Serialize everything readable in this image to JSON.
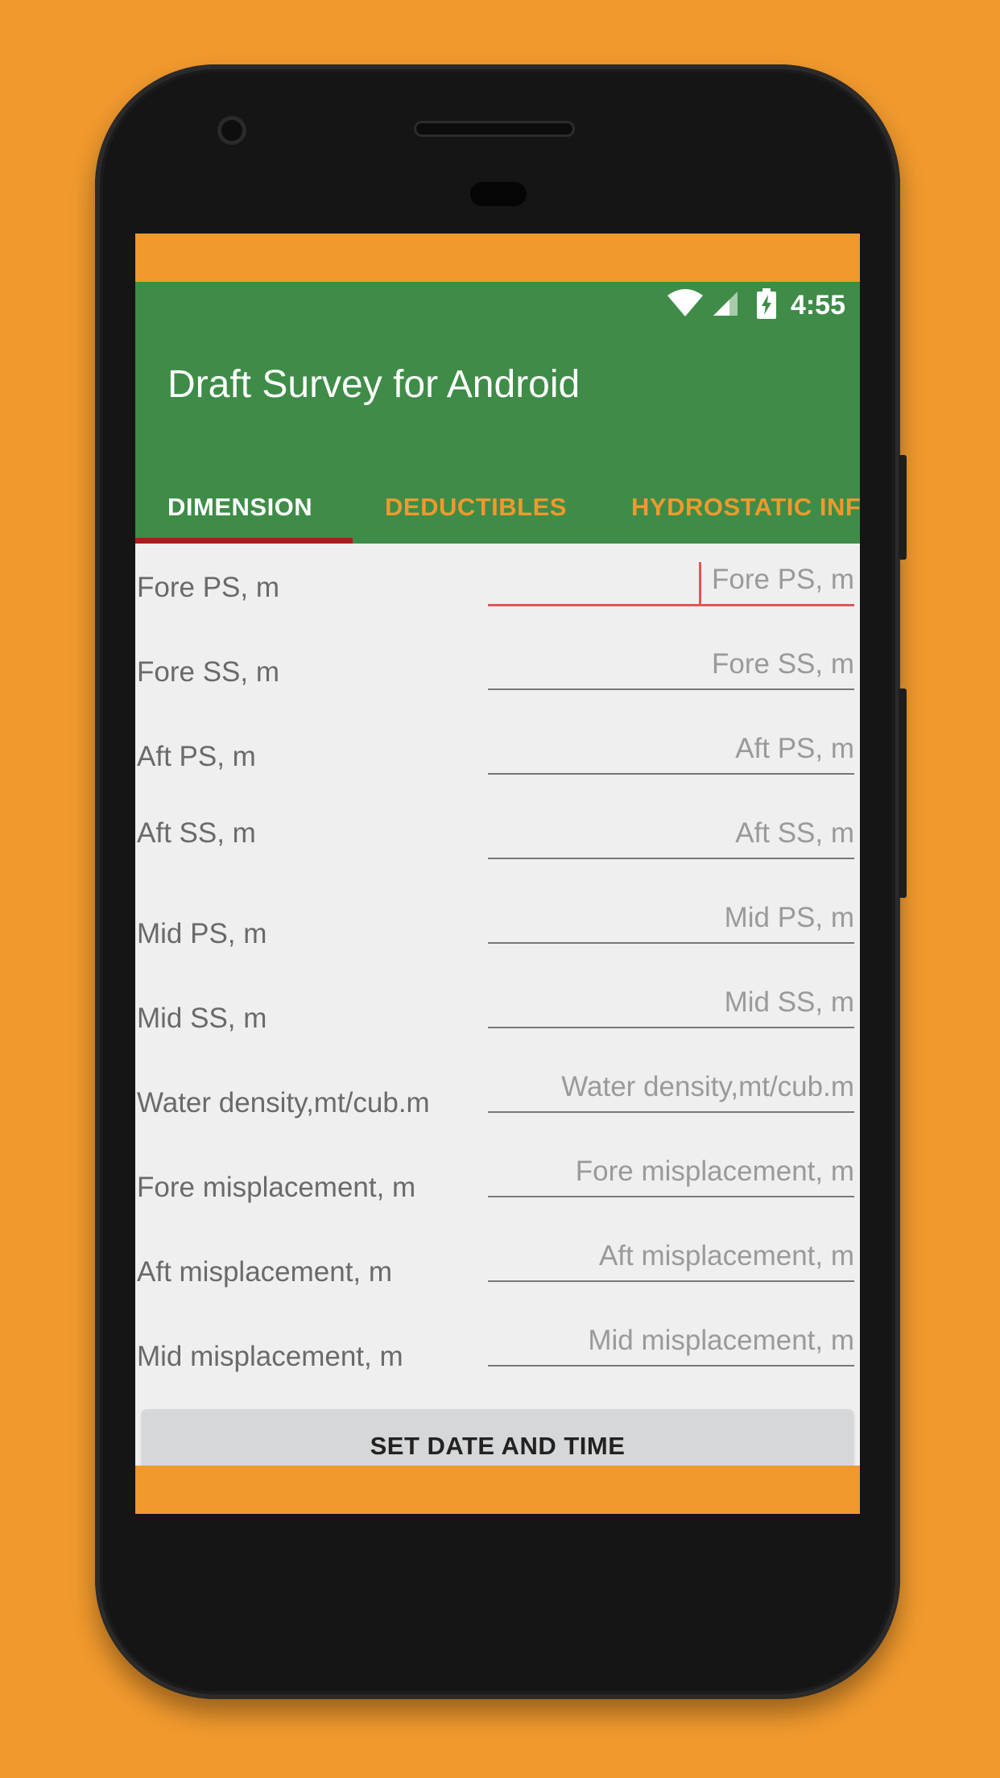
{
  "status_bar": {
    "time": "4:55",
    "icons": [
      "wifi-icon",
      "signal-icon",
      "battery-charging-icon"
    ]
  },
  "app_bar": {
    "title": "Draft Survey for Android"
  },
  "tabs": [
    {
      "label": "DIMENSION",
      "active": true
    },
    {
      "label": "DEDUCTIBLES",
      "active": false
    },
    {
      "label": "HYDROSTATIC INF",
      "active": false
    }
  ],
  "fields": [
    {
      "label": "Fore PS, m",
      "placeholder": "Fore PS, m",
      "value": ""
    },
    {
      "label": "Fore SS, m",
      "placeholder": "Fore SS, m",
      "value": ""
    },
    {
      "label": "Aft PS, m",
      "placeholder": "Aft PS, m",
      "value": ""
    },
    {
      "label": "Aft SS, m",
      "placeholder": "Aft SS, m",
      "value": ""
    },
    {
      "label": "Mid PS, m",
      "placeholder": "Mid PS, m",
      "value": ""
    },
    {
      "label": "Mid SS, m",
      "placeholder": "Mid SS, m",
      "value": ""
    },
    {
      "label": "Water density,mt/cub.m",
      "placeholder": "Water density,mt/cub.m",
      "value": ""
    },
    {
      "label": "Fore misplacement, m",
      "placeholder": "Fore misplacement, m",
      "value": ""
    },
    {
      "label": "Aft misplacement, m",
      "placeholder": "Aft misplacement, m",
      "value": ""
    },
    {
      "label": "Mid misplacement, m",
      "placeholder": "Mid misplacement, m",
      "value": ""
    }
  ],
  "button": {
    "label": "SET DATE AND TIME"
  },
  "colors": {
    "background": "#F0992D",
    "app_bar": "#3E8C47",
    "tab_indicator": "#A51F1F",
    "focus_underline": "#E25555"
  }
}
